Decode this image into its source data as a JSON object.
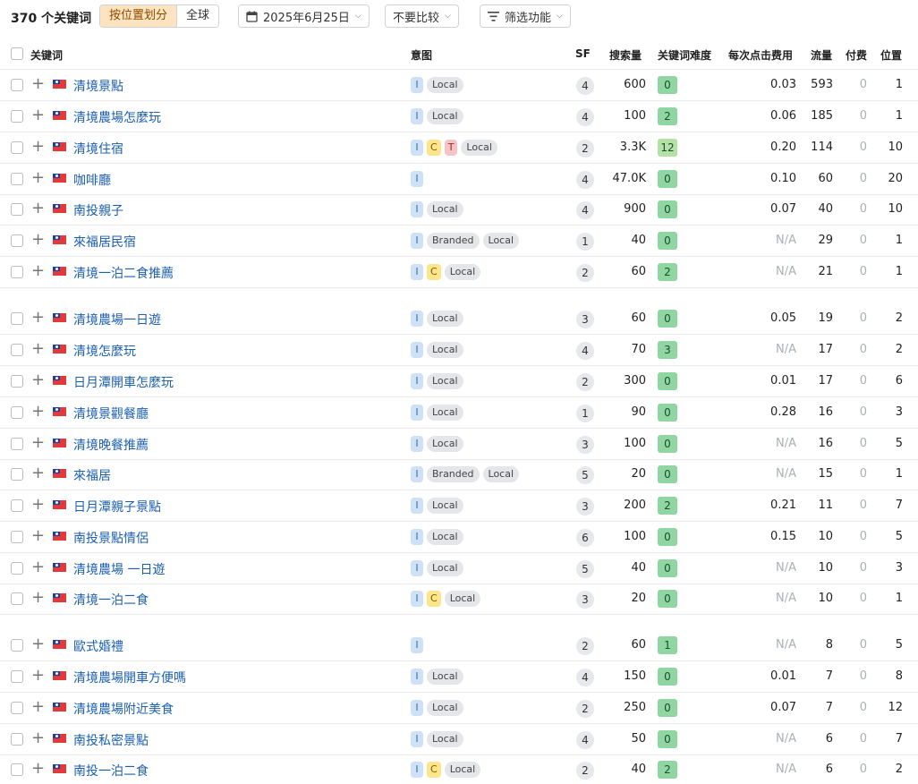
{
  "toolbar": {
    "count_label": "370 个关键词",
    "segment": [
      "按位置划分",
      "全球"
    ],
    "date_label": "2025年6月25日",
    "compare_label": "不要比较",
    "filter_label": "筛选功能"
  },
  "columns": {
    "keyword": "关键词",
    "intent": "意图",
    "sf": "SF",
    "volume": "搜索量",
    "kd": "关键词难度",
    "cpc": "每次点击费用",
    "traffic": "流量",
    "paid": "付费",
    "position": "位置"
  },
  "rows": [
    {
      "kw": "清境景點",
      "i": [
        "I"
      ],
      "tags": [
        "Local"
      ],
      "sf": "4",
      "vol": "600",
      "kd": "0",
      "cpc": "0.03",
      "traffic": "593",
      "paid": "0",
      "pos": "1"
    },
    {
      "kw": "清境農場怎麼玩",
      "i": [
        "I"
      ],
      "tags": [
        "Local"
      ],
      "sf": "4",
      "vol": "100",
      "kd": "2",
      "cpc": "0.06",
      "traffic": "185",
      "paid": "0",
      "pos": "1"
    },
    {
      "kw": "清境住宿",
      "i": [
        "I",
        "C",
        "T"
      ],
      "tags": [
        "Local"
      ],
      "sf": "2",
      "vol": "3.3K",
      "kd": "12",
      "cpc": "0.20",
      "traffic": "114",
      "paid": "0",
      "pos": "10"
    },
    {
      "kw": "咖啡廳",
      "i": [
        "I"
      ],
      "tags": [],
      "sf": "4",
      "vol": "47.0K",
      "kd": "0",
      "cpc": "0.10",
      "traffic": "60",
      "paid": "0",
      "pos": "20"
    },
    {
      "kw": "南投親子",
      "i": [
        "I"
      ],
      "tags": [
        "Local"
      ],
      "sf": "4",
      "vol": "900",
      "kd": "0",
      "cpc": "0.07",
      "traffic": "40",
      "paid": "0",
      "pos": "10"
    },
    {
      "kw": "來福居民宿",
      "i": [
        "I"
      ],
      "tags": [
        "Branded",
        "Local"
      ],
      "sf": "1",
      "vol": "40",
      "kd": "0",
      "cpc": "N/A",
      "traffic": "29",
      "paid": "0",
      "pos": "1"
    },
    {
      "kw": "清境一泊二食推薦",
      "i": [
        "I",
        "C"
      ],
      "tags": [
        "Local"
      ],
      "sf": "2",
      "vol": "60",
      "kd": "2",
      "cpc": "N/A",
      "traffic": "21",
      "paid": "0",
      "pos": "1"
    },
    {
      "kw": "清境農場一日遊",
      "i": [
        "I"
      ],
      "tags": [
        "Local"
      ],
      "sf": "3",
      "vol": "60",
      "kd": "0",
      "cpc": "0.05",
      "traffic": "19",
      "paid": "0",
      "pos": "2"
    },
    {
      "kw": "清境怎麼玩",
      "i": [
        "I"
      ],
      "tags": [
        "Local"
      ],
      "sf": "4",
      "vol": "70",
      "kd": "3",
      "cpc": "N/A",
      "traffic": "17",
      "paid": "0",
      "pos": "2"
    },
    {
      "kw": "日月潭開車怎麼玩",
      "i": [
        "I"
      ],
      "tags": [
        "Local"
      ],
      "sf": "2",
      "vol": "300",
      "kd": "0",
      "cpc": "0.01",
      "traffic": "17",
      "paid": "0",
      "pos": "6"
    },
    {
      "kw": "清境景觀餐廳",
      "i": [
        "I"
      ],
      "tags": [
        "Local"
      ],
      "sf": "1",
      "vol": "90",
      "kd": "0",
      "cpc": "0.28",
      "traffic": "16",
      "paid": "0",
      "pos": "3"
    },
    {
      "kw": "清境晚餐推薦",
      "i": [
        "I"
      ],
      "tags": [
        "Local"
      ],
      "sf": "3",
      "vol": "100",
      "kd": "0",
      "cpc": "N/A",
      "traffic": "16",
      "paid": "0",
      "pos": "5"
    },
    {
      "kw": "來福居",
      "i": [
        "I"
      ],
      "tags": [
        "Branded",
        "Local"
      ],
      "sf": "5",
      "vol": "20",
      "kd": "0",
      "cpc": "N/A",
      "traffic": "15",
      "paid": "0",
      "pos": "1"
    },
    {
      "kw": "日月潭親子景點",
      "i": [
        "I"
      ],
      "tags": [
        "Local"
      ],
      "sf": "3",
      "vol": "200",
      "kd": "2",
      "cpc": "0.21",
      "traffic": "11",
      "paid": "0",
      "pos": "7"
    },
    {
      "kw": "南投景點情侶",
      "i": [
        "I"
      ],
      "tags": [
        "Local"
      ],
      "sf": "6",
      "vol": "100",
      "kd": "0",
      "cpc": "0.15",
      "traffic": "10",
      "paid": "0",
      "pos": "5"
    },
    {
      "kw": "清境農場 一日遊",
      "i": [
        "I"
      ],
      "tags": [
        "Local"
      ],
      "sf": "5",
      "vol": "40",
      "kd": "0",
      "cpc": "N/A",
      "traffic": "10",
      "paid": "0",
      "pos": "3"
    },
    {
      "kw": "清境一泊二食",
      "i": [
        "I",
        "C"
      ],
      "tags": [
        "Local"
      ],
      "sf": "3",
      "vol": "20",
      "kd": "0",
      "cpc": "N/A",
      "traffic": "10",
      "paid": "0",
      "pos": "1"
    },
    {
      "kw": "歐式婚禮",
      "i": [
        "I"
      ],
      "tags": [],
      "sf": "2",
      "vol": "60",
      "kd": "1",
      "cpc": "N/A",
      "traffic": "8",
      "paid": "0",
      "pos": "5"
    },
    {
      "kw": "清境農場開車方便嗎",
      "i": [
        "I"
      ],
      "tags": [
        "Local"
      ],
      "sf": "4",
      "vol": "150",
      "kd": "0",
      "cpc": "0.01",
      "traffic": "7",
      "paid": "0",
      "pos": "8"
    },
    {
      "kw": "清境農場附近美食",
      "i": [
        "I"
      ],
      "tags": [
        "Local"
      ],
      "sf": "2",
      "vol": "250",
      "kd": "0",
      "cpc": "0.07",
      "traffic": "7",
      "paid": "0",
      "pos": "12"
    },
    {
      "kw": "南投私密景點",
      "i": [
        "I"
      ],
      "tags": [
        "Local"
      ],
      "sf": "4",
      "vol": "50",
      "kd": "0",
      "cpc": "N/A",
      "traffic": "6",
      "paid": "0",
      "pos": "7"
    },
    {
      "kw": "南投一泊二食",
      "i": [
        "I",
        "C"
      ],
      "tags": [
        "Local"
      ],
      "sf": "2",
      "vol": "40",
      "kd": "2",
      "cpc": "N/A",
      "traffic": "6",
      "paid": "0",
      "pos": "2"
    }
  ]
}
